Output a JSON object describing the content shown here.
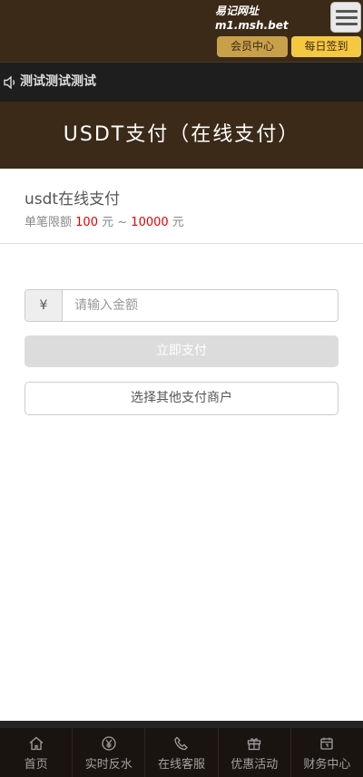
{
  "header": {
    "site_line1": "易记网址",
    "site_line2": "m1.msh.bet",
    "member_label": "会员中心",
    "sign_label": "每日签到"
  },
  "notice": {
    "text": "测试测试测试"
  },
  "page": {
    "title": "USDT支付（在线支付）"
  },
  "payment": {
    "name": "usdt在线支付",
    "limit_prefix": "单笔限额",
    "min": "100",
    "unit1": "元 ~",
    "max": "10000",
    "unit2": "元"
  },
  "form": {
    "currency_symbol": "¥",
    "amount_placeholder": "请输入金额",
    "pay_label": "立即支付",
    "other_label": "选择其他支付商户"
  },
  "nav": {
    "home": "首页",
    "rebate": "实时反水",
    "service": "在线客服",
    "promo": "优惠活动",
    "finance": "财务中心"
  }
}
